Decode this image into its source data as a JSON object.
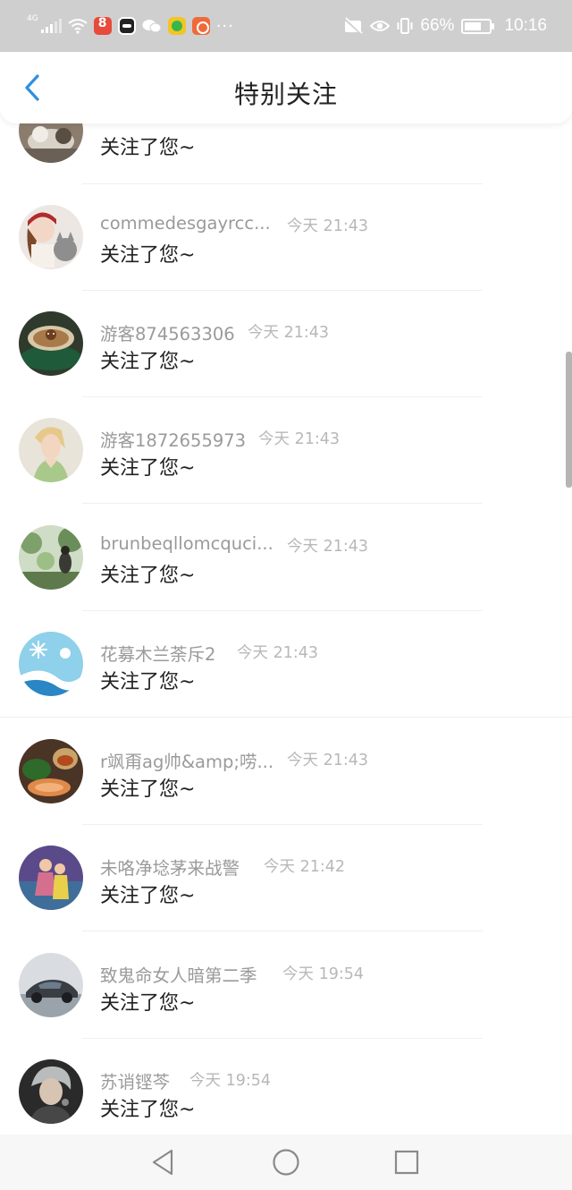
{
  "status_bar": {
    "network": "4G",
    "battery": "66%",
    "time": "10:16",
    "more": "···"
  },
  "header": {
    "title": "特别关注",
    "back_icon": "chevron-left-icon"
  },
  "list": {
    "items": [
      {
        "name": "",
        "time": "",
        "message": "关注了您~",
        "avatar": "dog-photo"
      },
      {
        "name": "commedesgayrcc...",
        "time": "今天 21:43",
        "message": "关注了您~",
        "avatar": "doll-and-cat"
      },
      {
        "name": "游客874563306",
        "time": "今天 21:43",
        "message": "关注了您~",
        "avatar": "coffee-cup"
      },
      {
        "name": "游客1872655973",
        "time": "今天 21:43",
        "message": "关注了您~",
        "avatar": "blonde-woman"
      },
      {
        "name": "brunbeqllomcquci...",
        "time": "今天 21:43",
        "message": "关注了您~",
        "avatar": "garden-scene"
      },
      {
        "name": "花募木兰荼斥2",
        "time": "今天 21:43",
        "message": "关注了您~",
        "avatar": "snowflake-pattern"
      },
      {
        "name": "r飒甭ag帅&amp;唠...",
        "time": "今天 21:43",
        "message": "关注了您~",
        "avatar": "food-plate"
      },
      {
        "name": "未咯净埝茅来战警",
        "time": "今天 21:42",
        "message": "关注了您~",
        "avatar": "couple-illustration"
      },
      {
        "name": "致鬼命女人暗第二季",
        "time": "今天 19:54",
        "message": "关注了您~",
        "avatar": "sports-car"
      },
      {
        "name": "苏诮铿芩",
        "time": "今天 19:54",
        "message": "关注了您~",
        "avatar": "gray-hair-person"
      }
    ]
  },
  "nav_bar": {
    "back": "triangle-back-icon",
    "home": "circle-home-icon",
    "recents": "square-recents-icon"
  },
  "colors": {
    "accent": "#2e8fe0",
    "status_bar_bg": "#cfcfcf",
    "name_text": "#9a9a9a",
    "time_text": "#b8b8b8"
  }
}
